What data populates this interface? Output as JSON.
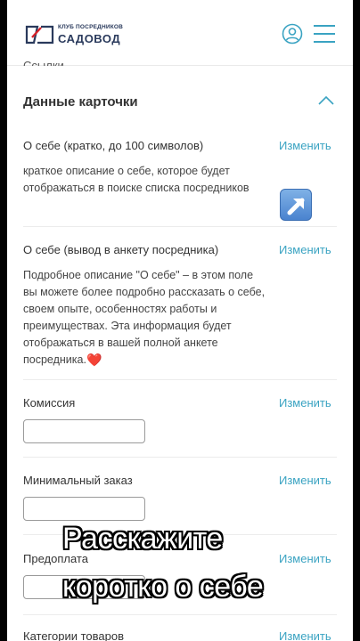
{
  "header": {
    "logo_small": "КЛУБ ПОСРЕДНИКОВ",
    "logo_big": "САДОВОД",
    "brand_colors": {
      "navy": "#2a3a5c",
      "red": "#d8232a",
      "accent": "#3aa3c2"
    }
  },
  "previous_row_text": "Ссылки",
  "card_section": {
    "title": "Данные карточки",
    "fields": [
      {
        "label": "О себе (кратко, до 100 символов)",
        "edit_label": "Изменить",
        "value": "краткое описание о себе, которое будет отображаться в поиске списка посредников"
      },
      {
        "label": "О себе (вывод в анкету посредника)",
        "edit_label": "Изменить",
        "value": "Подробное описание \"О себе\" – в этом поле вы можете более подробно рассказать о себе, своем опыте, особенностях работы и преимуществах. Эта информация будет отображаться в вашей полной анкете посредника."
      },
      {
        "label": "Комиссия",
        "edit_label": "Изменить",
        "value": ""
      },
      {
        "label": "Минимальный заказ",
        "edit_label": "Изменить",
        "value": ""
      },
      {
        "label": "Предоплата",
        "edit_label": "Изменить",
        "value": ""
      },
      {
        "label": "Категории товаров",
        "edit_label": "Изменить"
      }
    ]
  },
  "overlay": {
    "caption_line1": "Расскажите",
    "caption_line2": "коротко о себе",
    "emoji_heart": "❤️",
    "emoji_arrow": "↗"
  }
}
